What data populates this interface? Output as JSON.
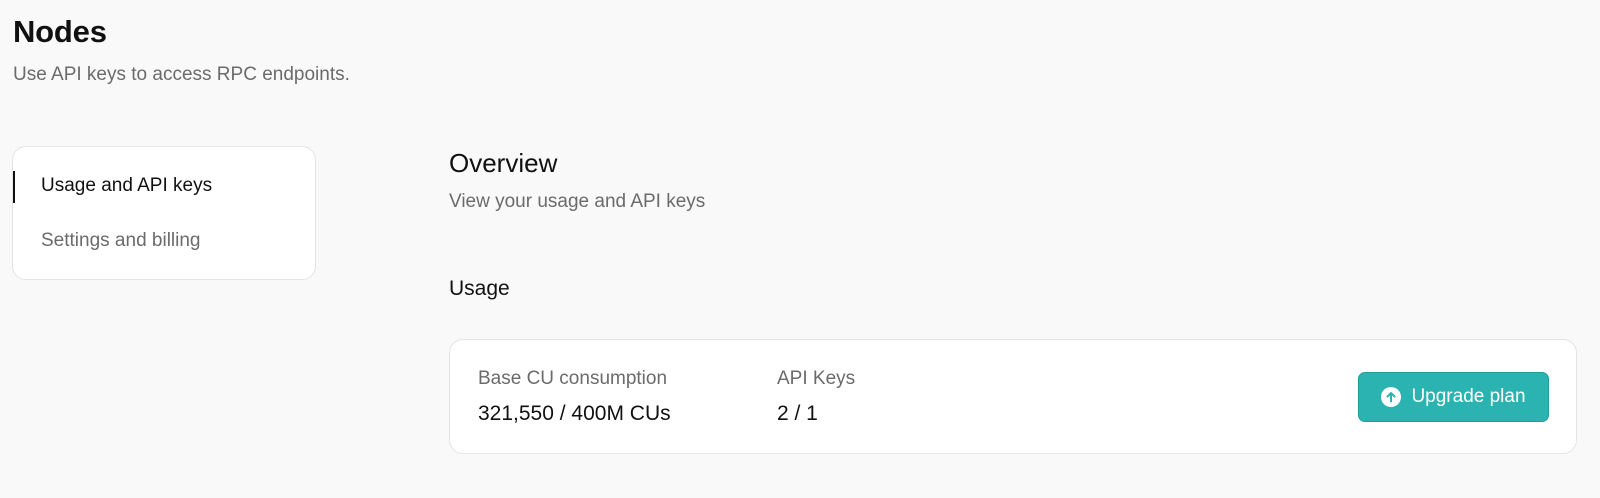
{
  "header": {
    "title": "Nodes",
    "subtitle": "Use API keys to access RPC endpoints."
  },
  "sidebar": {
    "items": [
      {
        "label": "Usage and API keys",
        "active": true
      },
      {
        "label": "Settings and billing",
        "active": false
      }
    ]
  },
  "main": {
    "title": "Overview",
    "subtitle": "View your usage and API keys",
    "usage": {
      "heading": "Usage",
      "metrics": [
        {
          "label": "Base CU consumption",
          "value": "321,550 / 400M CUs"
        },
        {
          "label": "API Keys",
          "value": "2 / 1"
        }
      ],
      "upgrade_button": {
        "label": "Upgrade plan",
        "icon": "arrow-up-circle-icon",
        "color": "#2bb3b1"
      }
    }
  }
}
